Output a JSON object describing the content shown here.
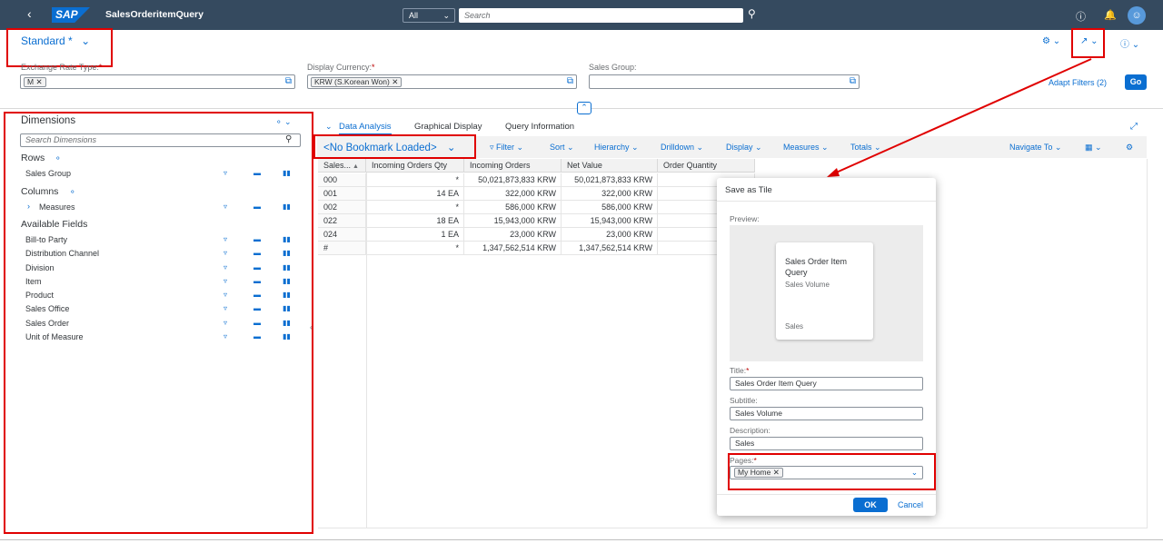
{
  "shell": {
    "back_icon": "back-icon",
    "logo": "SAP",
    "title": "SalesOrderitemQuery",
    "search_scope": "All",
    "search_placeholder": "Search",
    "icons": [
      "help-icon",
      "notification-bell-icon",
      "user-avatar-icon"
    ]
  },
  "variant": {
    "name": "Standard *"
  },
  "filters": [
    {
      "label": "Exchange Rate Type:",
      "token": "M"
    },
    {
      "label": "Display Currency:",
      "token": "KRW (S.Korean Won)"
    },
    {
      "label": "Sales Group:",
      "token": ""
    }
  ],
  "adapt_filters": "Adapt Filters (2)",
  "go_button": "Go",
  "dimensions": {
    "title": "Dimensions",
    "search_placeholder": "Search Dimensions",
    "rows_label": "Rows",
    "rows": [
      "Sales Group"
    ],
    "columns_label": "Columns",
    "columns": [
      "Measures"
    ],
    "available_label": "Available Fields",
    "available": [
      "Bill-to Party",
      "Distribution Channel",
      "Division",
      "Item",
      "Product",
      "Sales Office",
      "Sales Order",
      "Unit of Measure"
    ]
  },
  "tabs": [
    "Data Analysis",
    "Graphical Display",
    "Query Information"
  ],
  "toolbar": {
    "bookmark": "<No Bookmark Loaded>",
    "items": [
      "Filter",
      "Sort",
      "Hierarchy",
      "Drilldown",
      "Display",
      "Measures",
      "Totals"
    ],
    "navigate": "Navigate To"
  },
  "table": {
    "headers": [
      "Sales...",
      "Incoming Orders Qty",
      "Incoming Orders",
      "Net Value",
      "Order Quantity"
    ],
    "rows": [
      [
        "000",
        "*",
        "50,021,873,833 KRW",
        "50,021,873,833 KRW",
        ""
      ],
      [
        "001",
        "14 EA",
        "322,000 KRW",
        "322,000 KRW",
        ""
      ],
      [
        "002",
        "*",
        "586,000 KRW",
        "586,000 KRW",
        ""
      ],
      [
        "022",
        "18 EA",
        "15,943,000 KRW",
        "15,943,000 KRW",
        ""
      ],
      [
        "024",
        "1 EA",
        "23,000 KRW",
        "23,000 KRW",
        ""
      ],
      [
        "#",
        "*",
        "1,347,562,514 KRW",
        "1,347,562,514 KRW",
        ""
      ]
    ]
  },
  "dialog": {
    "title": "Save as Tile",
    "preview_label": "Preview:",
    "tile_title": "Sales Order Item Query",
    "tile_subtitle": "Sales Volume",
    "tile_footer": "Sales",
    "title_label": "Title:",
    "title_value": "Sales Order Item Query",
    "subtitle_label": "Subtitle:",
    "subtitle_value": "Sales Volume",
    "description_label": "Description:",
    "description_value": "Sales",
    "pages_label": "Pages:",
    "pages_token": "My Home",
    "ok": "OK",
    "cancel": "Cancel"
  },
  "colors": {
    "accent": "#0a6ed1",
    "shell": "#354a5f",
    "highlight": "#e00000"
  }
}
